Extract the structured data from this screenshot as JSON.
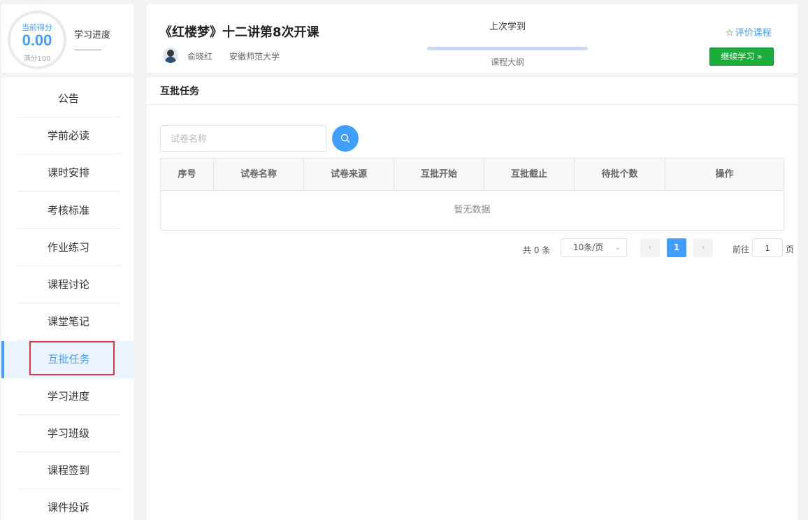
{
  "score": {
    "current_label": "当前得分",
    "value": "0.00",
    "full_label": "满分100",
    "tab_label": "学习进度"
  },
  "sidebar": {
    "items": [
      {
        "label": "公告"
      },
      {
        "label": "学前必读"
      },
      {
        "label": "课时安排"
      },
      {
        "label": "考核标准"
      },
      {
        "label": "作业练习"
      },
      {
        "label": "课程讨论"
      },
      {
        "label": "课堂笔记"
      },
      {
        "label": "互批任务",
        "active": true
      },
      {
        "label": "学习进度"
      },
      {
        "label": "学习班级"
      },
      {
        "label": "课程签到"
      },
      {
        "label": "课件投诉"
      }
    ]
  },
  "header": {
    "course_title": "《红楼梦》十二讲第8次开课",
    "teacher_name": "俞晓红",
    "school_name": "安徽师范大学",
    "last_learned_label": "上次学到",
    "outline_label": "课程大纲",
    "rate_link": "评价课程",
    "continue_button": "继续学习 »"
  },
  "main": {
    "section_title": "互批任务",
    "search": {
      "placeholder": "试卷名称",
      "value": ""
    },
    "table": {
      "columns": [
        "序号",
        "试卷名称",
        "试卷来源",
        "互批开始",
        "互批截止",
        "待批个数",
        "操作"
      ],
      "rows": [],
      "empty_text": "暂无数据"
    },
    "pagination": {
      "total_text": "共 0 条",
      "page_size": "10条/页",
      "current_page": "1",
      "goto_label": "前往",
      "goto_value": "1",
      "page_suffix": "页"
    }
  },
  "colors": {
    "accent": "#409eff",
    "continue_button": "#1aad3b",
    "highlight_box": "#e2363d"
  }
}
